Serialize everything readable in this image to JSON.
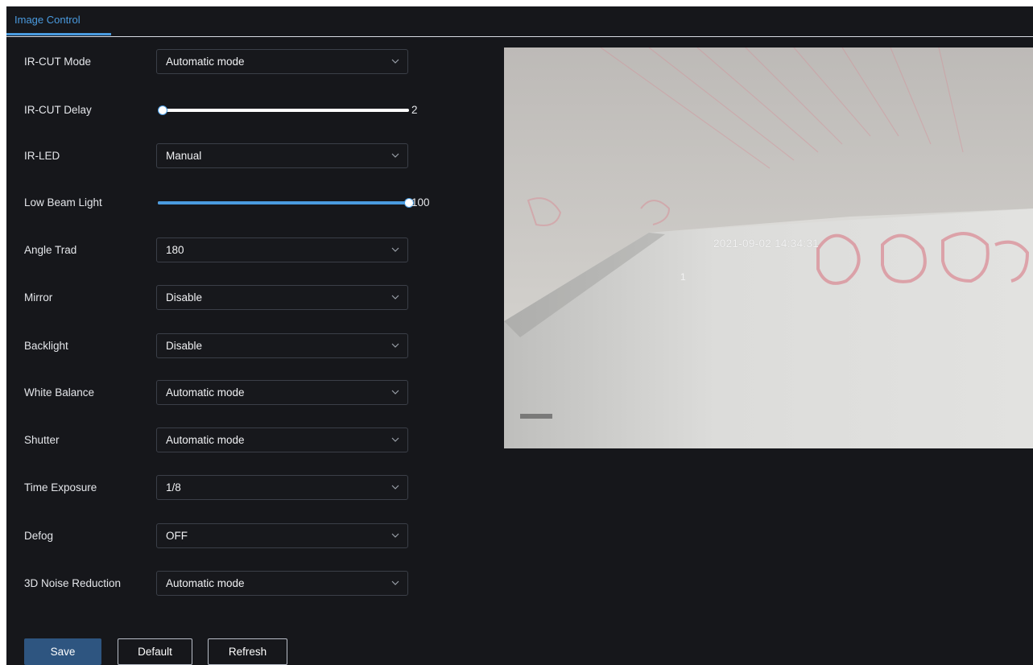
{
  "tabs": [
    {
      "label": "Image Control",
      "active": true
    }
  ],
  "settings": {
    "ir_cut_mode": {
      "label": "IR-CUT Mode",
      "value": "Automatic mode"
    },
    "ir_cut_delay": {
      "label": "IR-CUT Delay",
      "value": "2",
      "fraction": 0.02
    },
    "ir_led": {
      "label": "IR-LED",
      "value": "Manual"
    },
    "low_beam_light": {
      "label": "Low Beam Light",
      "value": "100",
      "fraction": 1.0
    },
    "angle_trad": {
      "label": "Angle Trad",
      "value": "180"
    },
    "mirror": {
      "label": "Mirror",
      "value": "Disable"
    },
    "backlight": {
      "label": "Backlight",
      "value": "Disable"
    },
    "white_balance": {
      "label": "White Balance",
      "value": "Automatic mode"
    },
    "shutter": {
      "label": "Shutter",
      "value": "Automatic mode"
    },
    "time_exposure": {
      "label": "Time Exposure",
      "value": "1/8"
    },
    "defog": {
      "label": "Defog",
      "value": "OFF"
    },
    "noise_reduction": {
      "label": "3D Noise Reduction",
      "value": "Automatic mode"
    }
  },
  "buttons": {
    "save": "Save",
    "default": "Default",
    "refresh": "Refresh"
  },
  "preview": {
    "timestamp": "2021-09-02 14:34:31",
    "channel": "1"
  },
  "icons": {
    "dropdown": "chevron-down-icon"
  },
  "colors": {
    "background": "#16171b",
    "accent": "#4a9be0",
    "primary_button": "#2e5580",
    "text": "#e4e6ea"
  }
}
